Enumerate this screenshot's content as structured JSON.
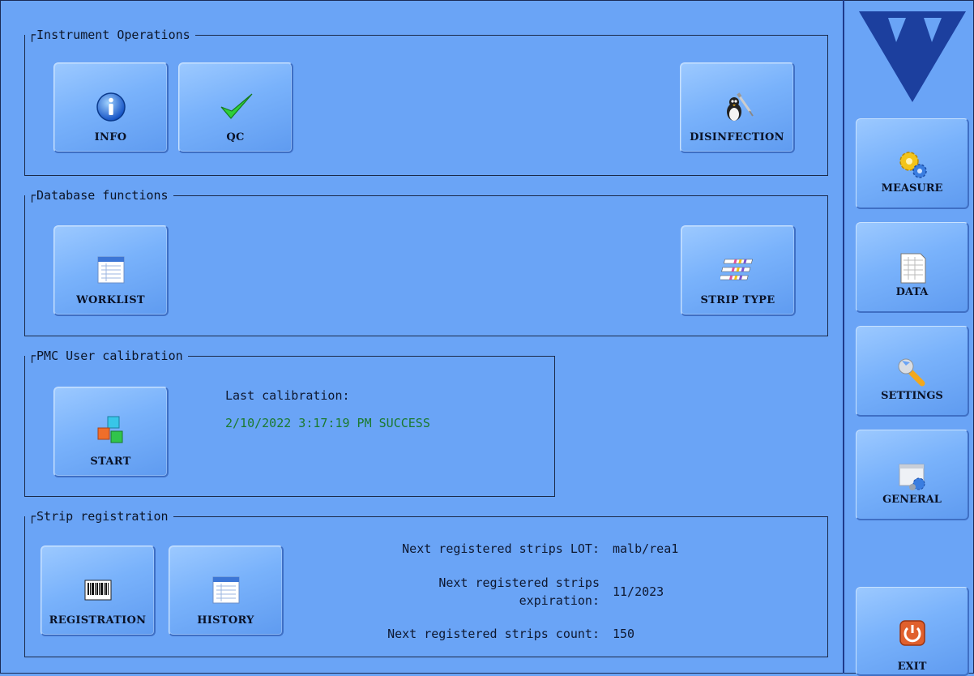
{
  "instrument_operations": {
    "title": "Instrument Operations",
    "info_label": "INFO",
    "qc_label": "QC",
    "disinfection_label": "DISINFECTION"
  },
  "database_functions": {
    "title": "Database functions",
    "worklist_label": "WORKLIST",
    "strip_type_label": "STRIP TYPE"
  },
  "calibration": {
    "title": "PMC User calibration",
    "start_label": "START",
    "last_label": "Last calibration:",
    "last_value": "2/10/2022 3:17:19 PM SUCCESS",
    "status_color": "#1b7a2e"
  },
  "strip_registration": {
    "title": "Strip registration",
    "registration_label": "REGISTRATION",
    "history_label": "HISTORY",
    "lot_label": "Next registered strips LOT:",
    "lot_value": "malb/rea1",
    "expiration_label_line1": "Next registered strips",
    "expiration_label_line2": "expiration:",
    "expiration_value": "11/2023",
    "count_label": "Next registered strips count:",
    "count_value": "150"
  },
  "sidebar": {
    "measure_label": "MEASURE",
    "data_label": "DATA",
    "settings_label": "SETTINGS",
    "general_label": "GENERAL",
    "exit_label": "EXIT"
  },
  "colors": {
    "background": "#6aa4f6",
    "logo": "#1c3f9e",
    "success_text": "#1b7a2e"
  }
}
